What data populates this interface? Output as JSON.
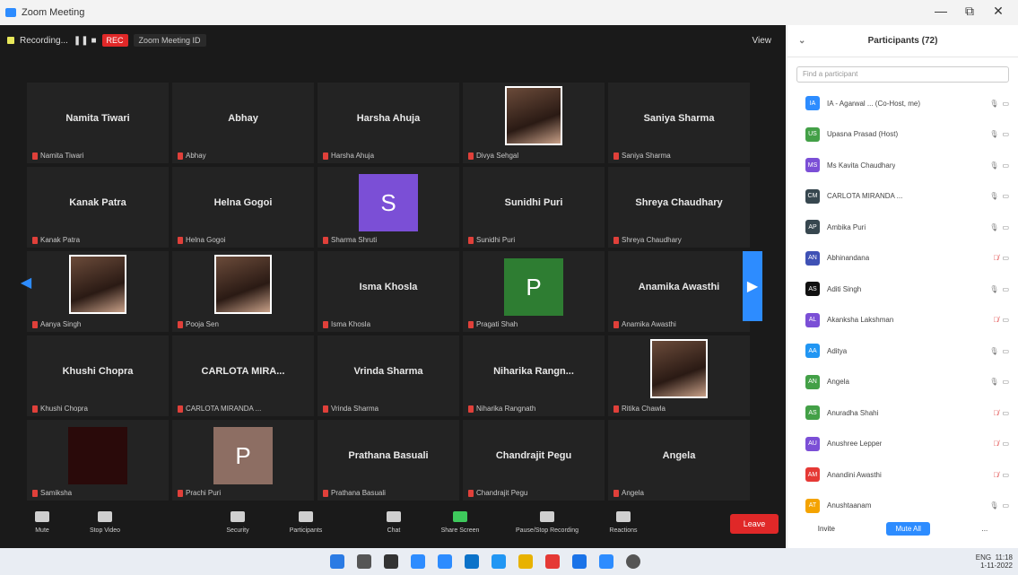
{
  "window": {
    "title": "Zoom Meeting",
    "minimize": "—",
    "maximize": "⧉",
    "close": "✕"
  },
  "topbar": {
    "meeting": "Recording...",
    "rec": "REC",
    "link": "Zoom Meeting ID",
    "view": "View"
  },
  "tiles": [
    {
      "name": "Namita Tiwari",
      "label": "Namita Tiwari",
      "type": "name"
    },
    {
      "name": "Abhay",
      "label": "Abhay",
      "type": "name"
    },
    {
      "name": "Harsha Ahuja",
      "label": "Harsha Ahuja",
      "type": "name"
    },
    {
      "name": "",
      "label": "Divya Sehgal",
      "type": "photo"
    },
    {
      "name": "Saniya Sharma",
      "label": "Saniya Sharma",
      "type": "name"
    },
    {
      "name": "Kanak Patra",
      "label": "Kanak Patra",
      "type": "name"
    },
    {
      "name": "Helna Gogoi",
      "label": "Helna Gogoi",
      "type": "name"
    },
    {
      "name": "S",
      "label": "Sharma Shruti",
      "type": "avatar",
      "color": "#7b4fd6"
    },
    {
      "name": "Sunidhi Puri",
      "label": "Sunidhi Puri",
      "type": "name"
    },
    {
      "name": "Shreya Chaudhary",
      "label": "Shreya Chaudhary",
      "type": "name"
    },
    {
      "name": "",
      "label": "Aanya Singh",
      "type": "photo"
    },
    {
      "name": "",
      "label": "Pooja Sen",
      "type": "photo"
    },
    {
      "name": "Isma Khosla",
      "label": "Isma Khosla",
      "type": "name"
    },
    {
      "name": "P",
      "label": "Pragati Shah",
      "type": "avatar",
      "color": "#2e7d32"
    },
    {
      "name": "Anamika Awasthi",
      "label": "Anamika Awasthi",
      "type": "name"
    },
    {
      "name": "Khushi Chopra",
      "label": "Khushi Chopra",
      "type": "name"
    },
    {
      "name": "CARLOTA MIRA...",
      "label": "CARLOTA MIRANDA ...",
      "type": "name"
    },
    {
      "name": "Vrinda Sharma",
      "label": "Vrinda Sharma",
      "type": "name"
    },
    {
      "name": "Niharika Rangn...",
      "label": "Niharika Rangnath",
      "type": "name"
    },
    {
      "name": "",
      "label": "Ritika Chawla",
      "type": "photo"
    },
    {
      "name": "",
      "label": "Samiksha",
      "type": "dark"
    },
    {
      "name": "P",
      "label": "Prachi Puri",
      "type": "avatar",
      "color": "#8d6e63"
    },
    {
      "name": "Prathana Basuali",
      "label": "Prathana Basuali",
      "type": "name"
    },
    {
      "name": "Chandrajit Pegu",
      "label": "Chandrajit Pegu",
      "type": "name"
    },
    {
      "name": "Angela",
      "label": "Angela",
      "type": "name"
    }
  ],
  "toolbar": {
    "mute": "Mute",
    "video": "Stop Video",
    "security": "Security",
    "participants": "Participants",
    "chat": "Chat",
    "share": "Share Screen",
    "record": "Pause/Stop Recording",
    "reactions": "Reactions",
    "end": "Leave"
  },
  "panel": {
    "title": "Participants (72)",
    "search": "Find a participant",
    "participants": [
      {
        "initials": "IA",
        "name": "IA - Agarwal ... (Co-Host, me)",
        "color": "#2d8cff",
        "muted": false
      },
      {
        "initials": "US",
        "name": "Upasna Prasad (Host)",
        "color": "#43a047",
        "muted": false
      },
      {
        "initials": "MS",
        "name": "Ms Kavita Chaudhary",
        "color": "#7b4fd6",
        "muted": false
      },
      {
        "initials": "CM",
        "name": "CARLOTA MIRANDA ...",
        "color": "#37474f",
        "muted": false
      },
      {
        "initials": "AP",
        "name": "Ambika Puri",
        "color": "#37474f",
        "muted": false
      },
      {
        "initials": "AN",
        "name": "Abhinandana",
        "color": "#3f51b5",
        "muted": true
      },
      {
        "initials": "AS",
        "name": "Aditi Singh",
        "color": "#111111",
        "muted": false
      },
      {
        "initials": "AL",
        "name": "Akanksha Lakshman",
        "color": "#7b4fd6",
        "muted": true
      },
      {
        "initials": "AA",
        "name": "Aditya",
        "color": "#2196f3",
        "muted": false
      },
      {
        "initials": "AN",
        "name": "Angela",
        "color": "#43a047",
        "muted": false
      },
      {
        "initials": "AS",
        "name": "Anuradha Shahi",
        "color": "#43a047",
        "muted": true
      },
      {
        "initials": "AU",
        "name": "Anushree Lepper",
        "color": "#7b4fd6",
        "muted": true
      },
      {
        "initials": "AM",
        "name": "Anandini Awasthi",
        "color": "#e53935",
        "muted": true
      },
      {
        "initials": "AT",
        "name": "Anushtaanam",
        "color": "#f4a300",
        "muted": false
      }
    ],
    "footer_invite": "Invite",
    "footer_mute": "Mute All",
    "footer_more": "..."
  },
  "taskbar": {
    "time": "11:18",
    "date": "1-11-2022",
    "lang": "ENG"
  }
}
